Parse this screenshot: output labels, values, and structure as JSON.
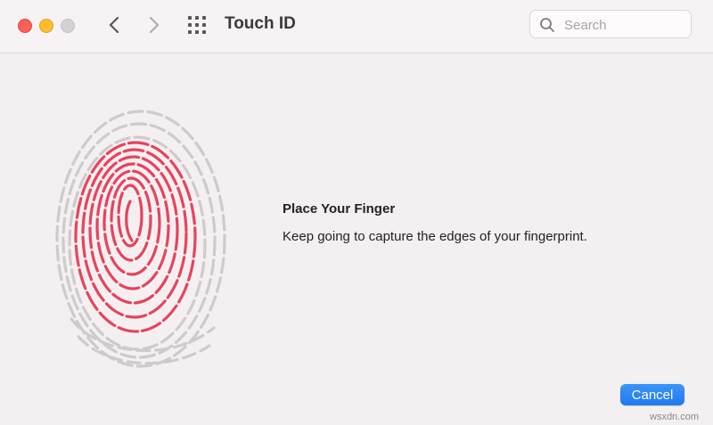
{
  "window": {
    "title": "Touch ID"
  },
  "search": {
    "placeholder": "Search"
  },
  "content": {
    "heading": "Place Your Finger",
    "message": "Keep going to capture the edges of your fingerprint."
  },
  "actions": {
    "cancel_label": "Cancel"
  },
  "watermark": "wsxdn.com",
  "colors": {
    "accent": "#2a86f5",
    "fingerprint_captured": "#e8435c",
    "fingerprint_pending": "#cfcbcd",
    "close": "#fe5f57",
    "minimize": "#febc2e",
    "zoom_inactive": "#d6d2d4"
  },
  "icons": {
    "back": "chevron-left-icon",
    "forward": "chevron-right-icon",
    "show_all": "grid-icon",
    "search": "magnifier-icon",
    "fingerprint": "fingerprint-icon"
  }
}
